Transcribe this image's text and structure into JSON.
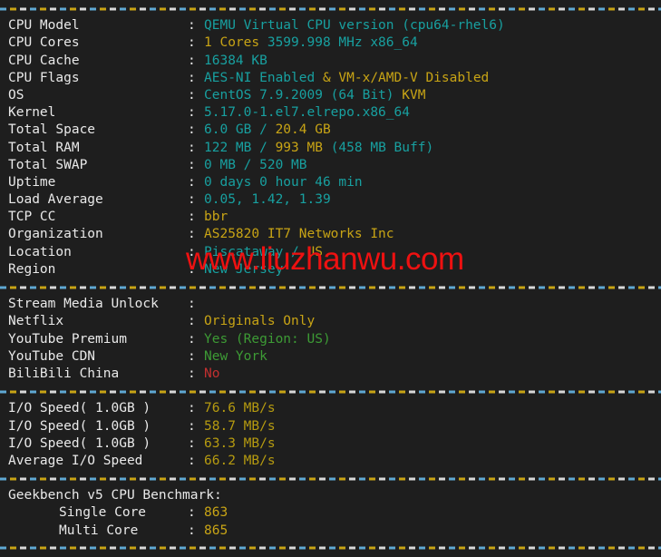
{
  "terminal": {
    "background_color": "#1e1e1e",
    "separator_colors": [
      "#5fa8d3",
      "#c8a415",
      "#d8d8d8"
    ],
    "colors": {
      "cyan": "#18a0a0",
      "yellow": "#c8a415",
      "green": "#3d9b35",
      "red": "#c33030",
      "olive": "#b69b10",
      "white": "#e9e9e9"
    },
    "colon": ":"
  },
  "watermark": {
    "text": "www.liuzhanwu.com",
    "color": "#ee1111"
  },
  "system_info": {
    "rows": [
      {
        "label": "CPU Model",
        "parts": [
          {
            "text": "QEMU Virtual CPU version (cpu64-rhel6)",
            "color": "cyan"
          }
        ]
      },
      {
        "label": "CPU Cores",
        "parts": [
          {
            "text": "1 Cores ",
            "color": "yellow"
          },
          {
            "text": "3599.998 MHz x86_64",
            "color": "cyan"
          }
        ]
      },
      {
        "label": "CPU Cache",
        "parts": [
          {
            "text": "16384 KB",
            "color": "cyan"
          }
        ]
      },
      {
        "label": "CPU Flags",
        "parts": [
          {
            "text": "AES-NI Enabled ",
            "color": "cyan"
          },
          {
            "text": "& VM-x/AMD-V Disabled",
            "color": "yellow"
          }
        ]
      },
      {
        "label": "OS",
        "parts": [
          {
            "text": "CentOS 7.9.2009 (64 Bit) ",
            "color": "cyan"
          },
          {
            "text": "KVM",
            "color": "yellow"
          }
        ]
      },
      {
        "label": "Kernel",
        "parts": [
          {
            "text": "5.17.0-1.el7.elrepo.x86_64",
            "color": "cyan"
          }
        ]
      },
      {
        "label": "Total Space",
        "parts": [
          {
            "text": "6.0 GB ",
            "color": "cyan"
          },
          {
            "text": "/ ",
            "color": "cyan"
          },
          {
            "text": "20.4 GB",
            "color": "yellow"
          }
        ]
      },
      {
        "label": "Total RAM",
        "parts": [
          {
            "text": "122 MB ",
            "color": "cyan"
          },
          {
            "text": "/ ",
            "color": "cyan"
          },
          {
            "text": "993 MB ",
            "color": "yellow"
          },
          {
            "text": "(458 MB Buff)",
            "color": "cyan"
          }
        ]
      },
      {
        "label": "Total SWAP",
        "parts": [
          {
            "text": "0 MB / 520 MB",
            "color": "cyan"
          }
        ]
      },
      {
        "label": "Uptime",
        "parts": [
          {
            "text": "0 days 0 hour 46 min",
            "color": "cyan"
          }
        ]
      },
      {
        "label": "Load Average",
        "parts": [
          {
            "text": "0.05, 1.42, 1.39",
            "color": "cyan"
          }
        ]
      },
      {
        "label": "TCP CC",
        "parts": [
          {
            "text": "bbr",
            "color": "yellow"
          }
        ]
      },
      {
        "label": "Organization",
        "parts": [
          {
            "text": "AS25820 IT7 Networks Inc",
            "color": "yellow"
          }
        ]
      },
      {
        "label": "Location",
        "parts": [
          {
            "text": "Piscataway ",
            "color": "cyan"
          },
          {
            "text": "/ ",
            "color": "cyan"
          },
          {
            "text": "US",
            "color": "yellow"
          }
        ]
      },
      {
        "label": "Region",
        "parts": [
          {
            "text": "New Jersey",
            "color": "cyan"
          }
        ]
      }
    ]
  },
  "stream_media": {
    "rows": [
      {
        "label": "Stream Media Unlock",
        "parts": []
      },
      {
        "label": "Netflix",
        "parts": [
          {
            "text": "Originals Only",
            "color": "yellow"
          }
        ]
      },
      {
        "label": "YouTube Premium",
        "parts": [
          {
            "text": "Yes (Region: US)",
            "color": "green"
          }
        ]
      },
      {
        "label": "YouTube CDN",
        "parts": [
          {
            "text": "New York",
            "color": "green"
          }
        ]
      },
      {
        "label": "BiliBili China",
        "parts": [
          {
            "text": "No",
            "color": "red"
          }
        ]
      }
    ]
  },
  "io_speed": {
    "rows": [
      {
        "label": "I/O Speed( 1.0GB )",
        "parts": [
          {
            "text": "76.6 MB/s",
            "color": "olive"
          }
        ]
      },
      {
        "label": "I/O Speed( 1.0GB )",
        "parts": [
          {
            "text": "58.7 MB/s",
            "color": "olive"
          }
        ]
      },
      {
        "label": "I/O Speed( 1.0GB )",
        "parts": [
          {
            "text": "63.3 MB/s",
            "color": "olive"
          }
        ]
      },
      {
        "label": "Average I/O Speed",
        "parts": [
          {
            "text": "66.2 MB/s",
            "color": "olive"
          }
        ]
      }
    ]
  },
  "geekbench": {
    "title": "Geekbench v5 CPU Benchmark:",
    "rows": [
      {
        "label": "Single Core",
        "indent": true,
        "parts": [
          {
            "text": "863",
            "color": "yellow"
          }
        ]
      },
      {
        "label": "Multi Core",
        "indent": true,
        "parts": [
          {
            "text": "865",
            "color": "yellow"
          }
        ]
      }
    ]
  }
}
